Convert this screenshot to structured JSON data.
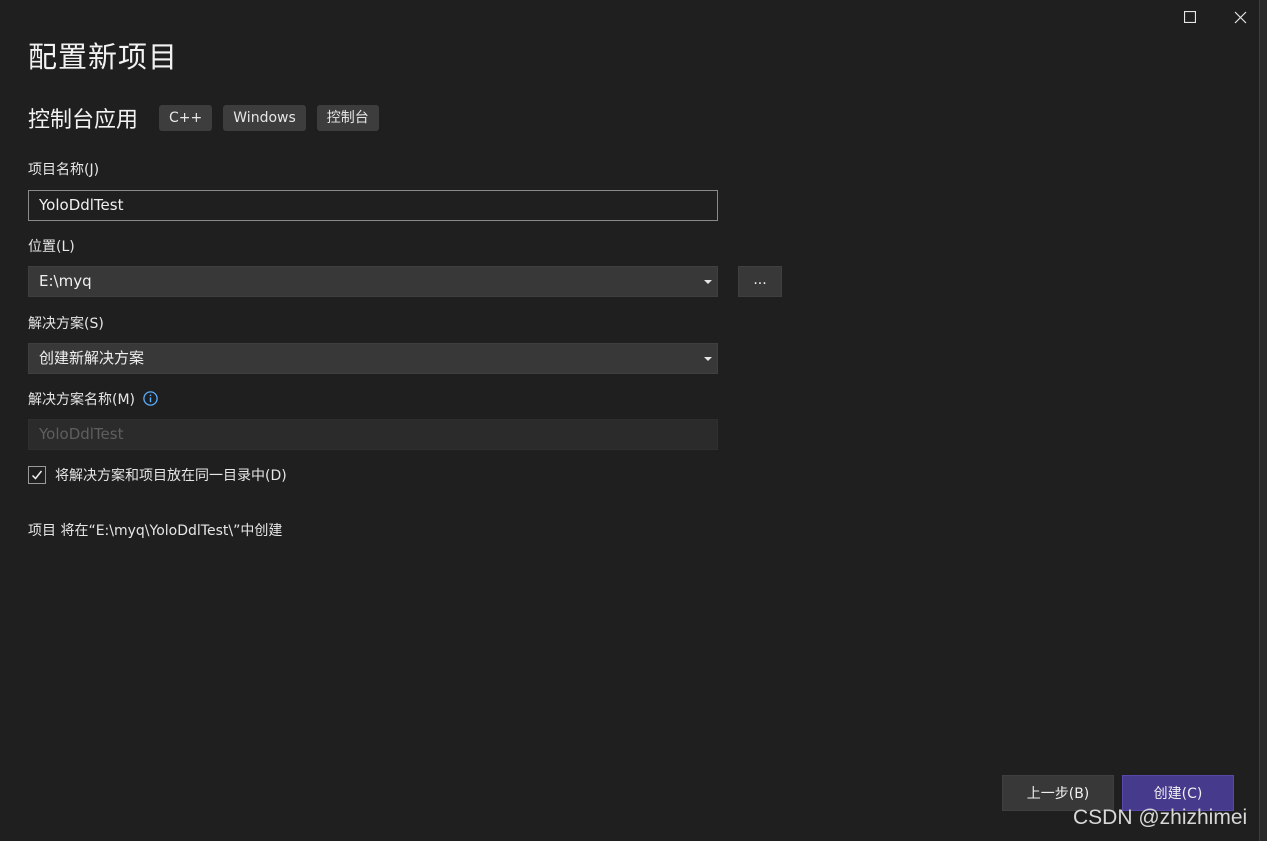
{
  "window": {
    "controls": {
      "maximize_icon": "maximize-square-icon",
      "close_icon": "close-x-icon"
    }
  },
  "page": {
    "title": "配置新项目"
  },
  "template": {
    "name": "控制台应用",
    "tags": [
      "C++",
      "Windows",
      "控制台"
    ]
  },
  "fields": {
    "project_name": {
      "label": "项目名称(J)",
      "value": "YoloDdlTest"
    },
    "location": {
      "label": "位置(L)",
      "value": "E:\\myq",
      "browse_label": "..."
    },
    "solution": {
      "label": "解决方案(S)",
      "value": "创建新解决方案"
    },
    "solution_name": {
      "label": "解决方案名称(M)",
      "value": "YoloDdlTest",
      "info_icon": "info-circle-icon",
      "disabled": true
    },
    "same_directory": {
      "label": "将解决方案和项目放在同一目录中(D)",
      "checked": true
    }
  },
  "summary": "项目 将在“E:\\myq\\YoloDdlTest\\”中创建",
  "buttons": {
    "back": "上一步(B)",
    "create": "创建(C)"
  },
  "watermark": "CSDN @zhizhimei",
  "colors": {
    "background": "#1f1f1f",
    "accent": "#463a8c",
    "info_icon": "#5aaeff"
  }
}
